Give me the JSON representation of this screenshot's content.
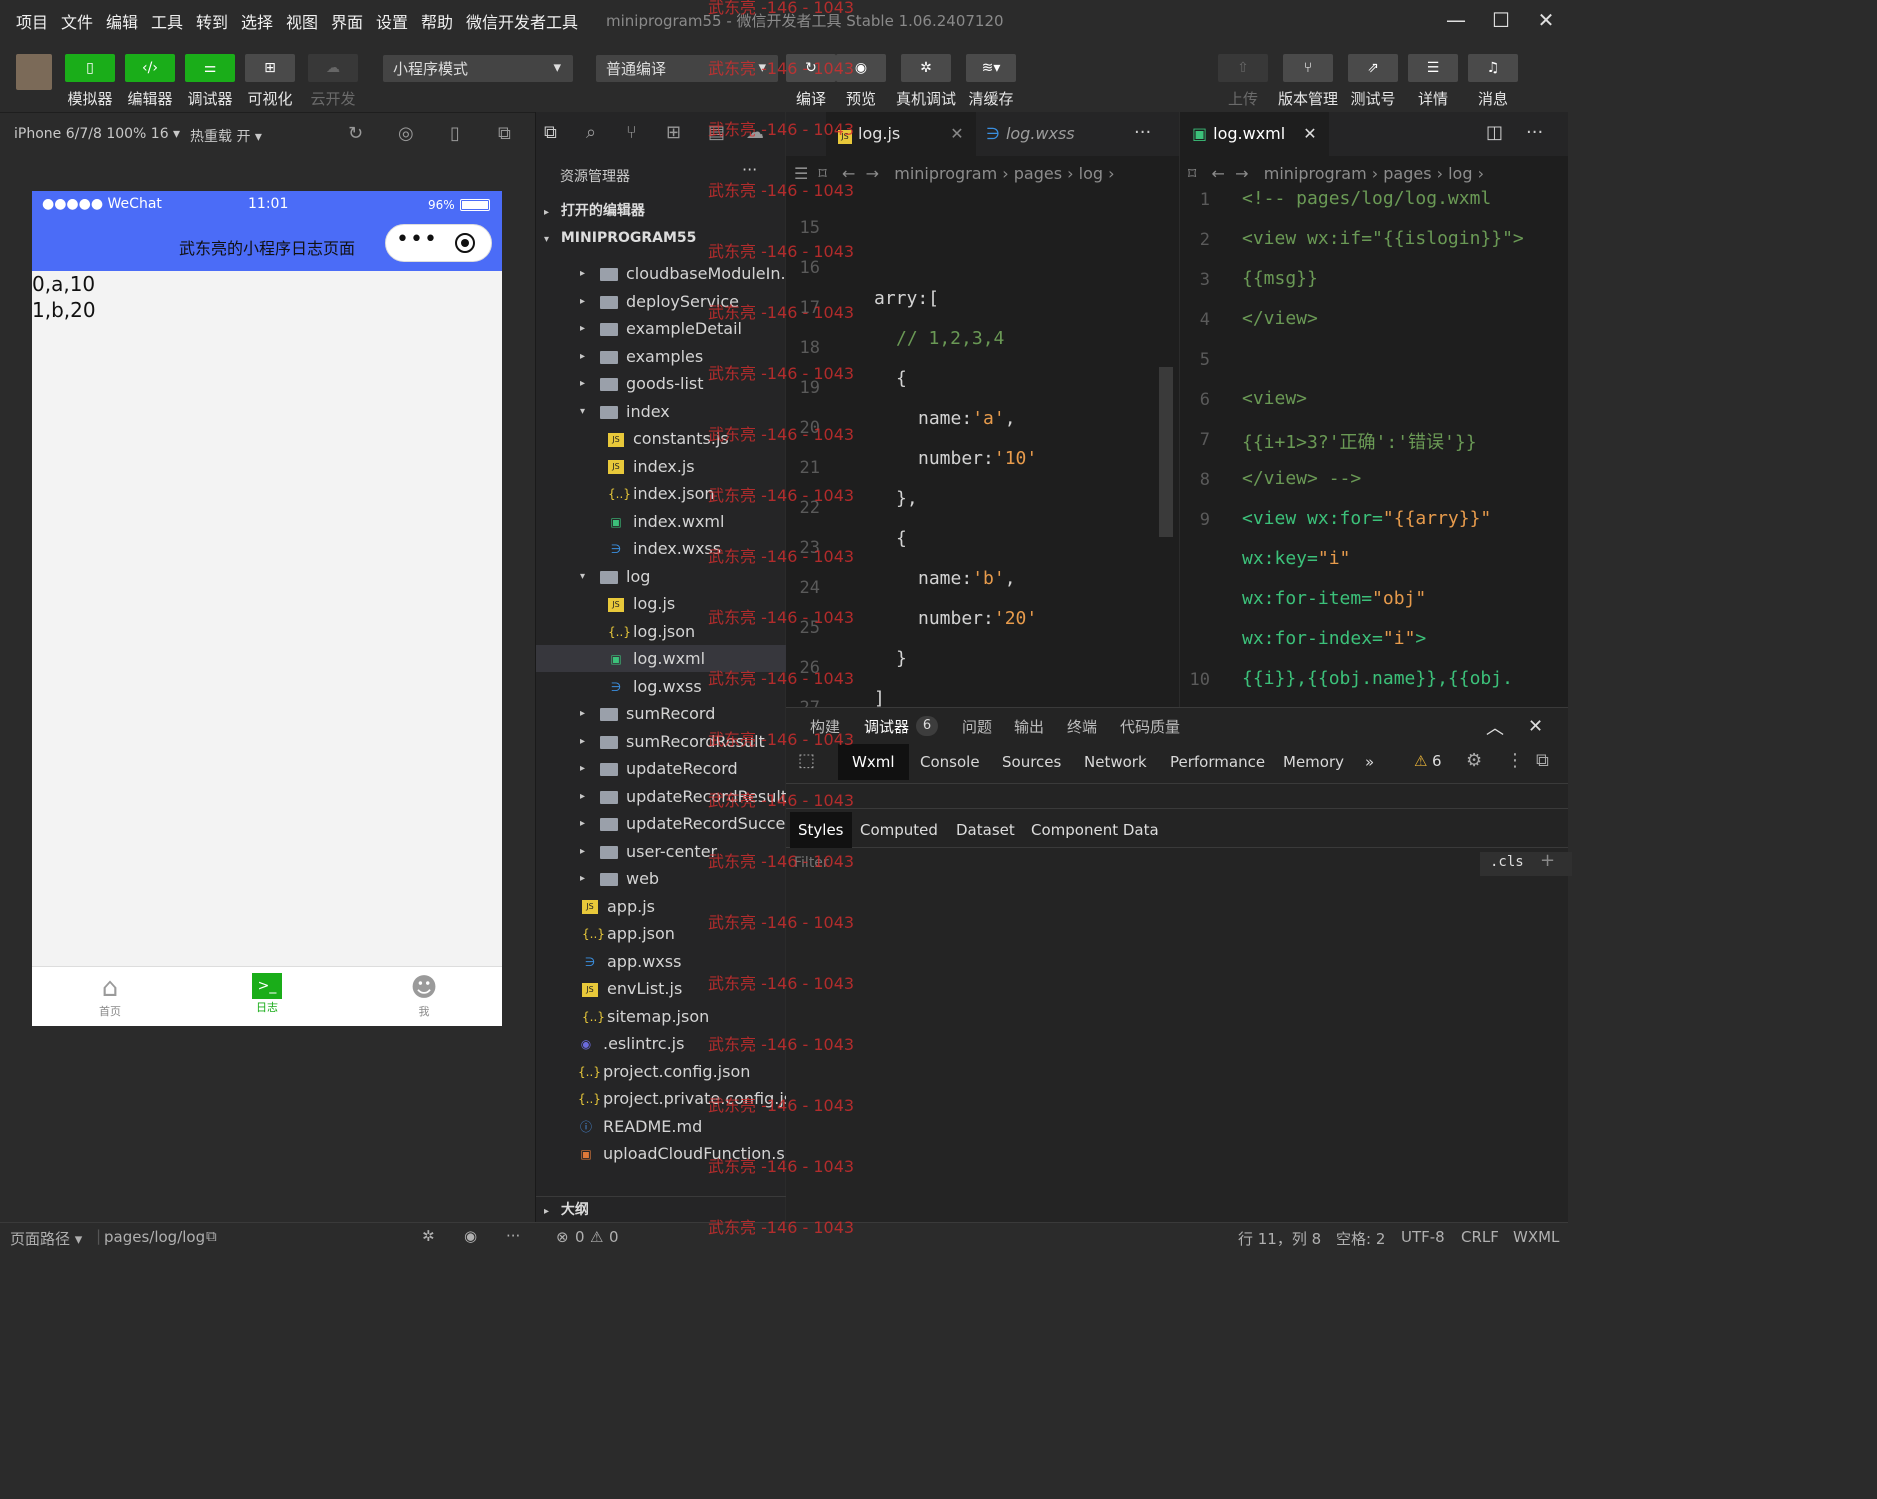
{
  "menu": [
    "项目",
    "文件",
    "编辑",
    "工具",
    "转到",
    "选择",
    "视图",
    "界面",
    "设置",
    "帮助",
    "微信开发者工具"
  ],
  "app_title": "miniprogram55 - 微信开发者工具 Stable 1.06.2407120",
  "window_controls": {
    "minimize": "—",
    "maximize": "☐",
    "close": "✕"
  },
  "toolbar": {
    "simulator": "模拟器",
    "editor": "编辑器",
    "debugger": "调试器",
    "visual": "可视化",
    "cloud": "云开发",
    "mode": "小程序模式",
    "compile_mode": "普通编译",
    "compile": "编译",
    "preview": "预览",
    "remote_debug": "真机调试",
    "clear_cache": "清缓存",
    "upload": "上传",
    "version": "版本管理",
    "test": "测试号",
    "details": "详情",
    "messages": "消息"
  },
  "sim": {
    "device": "iPhone 6/7/8 100% 16 ▾",
    "hot_reload": "热重载 开 ▾"
  },
  "phone": {
    "carrier": "●●●●● WeChat",
    "time": "11:01",
    "battery": "96%",
    "nav_title": "武东亮的小程序日志页面",
    "lines": [
      "0,a,10",
      "1,b,20"
    ],
    "tabs": [
      {
        "label": "首页"
      },
      {
        "label": "日志"
      },
      {
        "label": "我"
      }
    ]
  },
  "explorer": {
    "title": "资源管理器",
    "more": "···",
    "open_editors": "打开的编辑器",
    "project": "MINIPROGRAM55",
    "items": [
      {
        "name": "cloudbaseModuleIn...",
        "type": "folder",
        "indent": 1
      },
      {
        "name": "deployService",
        "type": "folder",
        "indent": 1
      },
      {
        "name": "exampleDetail",
        "type": "folder",
        "indent": 1
      },
      {
        "name": "examples",
        "type": "folder",
        "indent": 1
      },
      {
        "name": "goods-list",
        "type": "folder",
        "indent": 1
      },
      {
        "name": "index",
        "type": "folder-open",
        "indent": 1
      },
      {
        "name": "constants.js",
        "type": "js",
        "indent": 2
      },
      {
        "name": "index.js",
        "type": "js",
        "indent": 2
      },
      {
        "name": "index.json",
        "type": "json",
        "indent": 2
      },
      {
        "name": "index.wxml",
        "type": "wxml",
        "indent": 2
      },
      {
        "name": "index.wxss",
        "type": "wxss",
        "indent": 2
      },
      {
        "name": "log",
        "type": "folder-open",
        "indent": 1
      },
      {
        "name": "log.js",
        "type": "js",
        "indent": 2
      },
      {
        "name": "log.json",
        "type": "json",
        "indent": 2
      },
      {
        "name": "log.wxml",
        "type": "wxml",
        "indent": 2
      },
      {
        "name": "log.wxss",
        "type": "wxss",
        "indent": 2
      },
      {
        "name": "sumRecord",
        "type": "folder",
        "indent": 1
      },
      {
        "name": "sumRecordResult",
        "type": "folder",
        "indent": 1
      },
      {
        "name": "updateRecord",
        "type": "folder",
        "indent": 1
      },
      {
        "name": "updateRecordResult",
        "type": "folder",
        "indent": 1
      },
      {
        "name": "updateRecordSuccess",
        "type": "folder",
        "indent": 1
      },
      {
        "name": "user-center",
        "type": "folder",
        "indent": 1
      },
      {
        "name": "web",
        "type": "folder",
        "indent": 1
      },
      {
        "name": "app.js",
        "type": "js",
        "indent": 1
      },
      {
        "name": "app.json",
        "type": "json",
        "indent": 1
      },
      {
        "name": "app.wxss",
        "type": "wxss",
        "indent": 1
      },
      {
        "name": "envList.js",
        "type": "js",
        "indent": 1
      },
      {
        "name": "sitemap.json",
        "type": "json",
        "indent": 1
      },
      {
        "name": ".eslintrc.js",
        "type": "eslint",
        "indent": 0
      },
      {
        "name": "project.config.json",
        "type": "json",
        "indent": 0
      },
      {
        "name": "project.private.config.js...",
        "type": "json",
        "indent": 0
      },
      {
        "name": "README.md",
        "type": "info",
        "indent": 0
      },
      {
        "name": "uploadCloudFunction.sh",
        "type": "sh",
        "indent": 0
      }
    ],
    "outline": "大纲"
  },
  "editor1": {
    "tabs": [
      {
        "label": "log.js"
      },
      {
        "label": "log.wxss"
      }
    ],
    "breadcrumb": [
      "miniprogram",
      "pages",
      "log"
    ],
    "lines": [
      {
        "n": "15",
        "code": ""
      },
      {
        "n": "16",
        "code": "arry:["
      },
      {
        "n": "17",
        "code": "// 1,2,3,4"
      },
      {
        "n": "18",
        "code": "{"
      },
      {
        "n": "19",
        "code": "name:'a',"
      },
      {
        "n": "20",
        "code": "number:'10'"
      },
      {
        "n": "21",
        "code": "},"
      },
      {
        "n": "22",
        "code": "{"
      },
      {
        "n": "23",
        "code": "name:'b',"
      },
      {
        "n": "24",
        "code": "number:'20'"
      },
      {
        "n": "25",
        "code": "}"
      },
      {
        "n": "26",
        "code": "]"
      },
      {
        "n": "27",
        "code": "},"
      }
    ]
  },
  "editor2": {
    "tabs": [
      {
        "label": "log.wxml"
      }
    ],
    "breadcrumb": [
      "miniprogram",
      "pages",
      "log"
    ],
    "lines": [
      {
        "n": "1",
        "code": "<!-- pages/log/log.wxml"
      },
      {
        "n": "2",
        "code": "<view wx:if=\"{{islogin}}\">"
      },
      {
        "n": "3",
        "code": "{{msg}}"
      },
      {
        "n": "4",
        "code": "</view>"
      },
      {
        "n": "5",
        "code": ""
      },
      {
        "n": "6",
        "code": "<view>"
      },
      {
        "n": "7",
        "code": "{{i+1>3?'正确':'错误'}}"
      },
      {
        "n": "8",
        "code": "</view> -->"
      },
      {
        "n": "9",
        "code": "<view wx:for=\"{{arry}}\""
      },
      {
        "n": "",
        "code": "wx:key=\"i\""
      },
      {
        "n": "",
        "code": "wx:for-item=\"obj\""
      },
      {
        "n": "",
        "code": "wx:for-index=\"i\">"
      },
      {
        "n": "10",
        "code": "{{i}},{{obj.name}},{{obj."
      }
    ]
  },
  "debugger": {
    "tabs": [
      "构建",
      "调试器",
      "问题",
      "输出",
      "终端",
      "代码质量"
    ],
    "badge": "6",
    "devtools_tabs": [
      "Wxml",
      "Console",
      "Sources",
      "Network",
      "Performance",
      "Memory"
    ],
    "more": "»",
    "warnings": "6",
    "sub_tabs": [
      "Styles",
      "Computed",
      "Dataset",
      "Component Data"
    ],
    "filter_placeholder": "Filter",
    "cls": ".cls",
    "add": "+"
  },
  "status": {
    "page_path_label": "页面路径 ▾",
    "page_path": "pages/log/log",
    "errors": "0",
    "warnings": "0",
    "position": "行 11，列 8",
    "spaces": "空格: 2",
    "encoding": "UTF-8",
    "eol": "CRLF",
    "lang": "WXML"
  },
  "watermark": "武东亮 -146 - 1043"
}
